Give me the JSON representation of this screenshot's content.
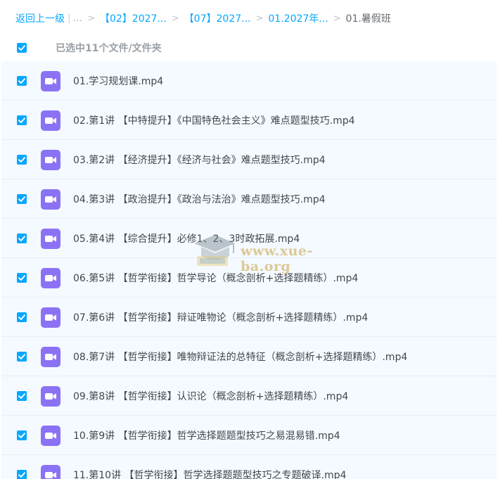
{
  "breadcrumb": {
    "back_label": "返回上一级",
    "separator_bar": "|",
    "ellipsis": "...",
    "separator": ">",
    "crumbs": [
      "【02】2027...",
      "【07】2027...",
      "01.2027年..."
    ],
    "current": "01.暑假班"
  },
  "selection": {
    "label": "已选中11个文件/文件夹",
    "all_checked": true
  },
  "files": [
    {
      "name": "01.学习规划课.mp4",
      "checked": true,
      "icon": "video-file-icon"
    },
    {
      "name": "02.第1讲 【中特提升】《中国特色社会主义》难点题型技巧.mp4",
      "checked": true,
      "icon": "video-file-icon"
    },
    {
      "name": "03.第2讲 【经济提升】《经济与社会》难点题型技巧.mp4",
      "checked": true,
      "icon": "video-file-icon"
    },
    {
      "name": "04.第3讲 【政治提升】《政治与法治》难点题型技巧.mp4",
      "checked": true,
      "icon": "video-file-icon"
    },
    {
      "name": "05.第4讲 【综合提升】必修1、2、3时政拓展.mp4",
      "checked": true,
      "icon": "video-file-icon"
    },
    {
      "name": "06.第5讲 【哲学衔接】哲学导论（概念剖析+选择题精练）.mp4",
      "checked": true,
      "icon": "video-file-icon"
    },
    {
      "name": "07.第6讲 【哲学衔接】辩证唯物论（概念剖析+选择题精练）.mp4",
      "checked": true,
      "icon": "video-file-icon"
    },
    {
      "name": "08.第7讲 【哲学衔接】唯物辩证法的总特征（概念剖析+选择题精练）.mp4",
      "checked": true,
      "icon": "video-file-icon"
    },
    {
      "name": "09.第8讲 【哲学衔接】认识论（概念剖析+选择题精练）.mp4",
      "checked": true,
      "icon": "video-file-icon"
    },
    {
      "name": "10.第9讲 【哲学衔接】哲学选择题题型技巧之易混易错.mp4",
      "checked": true,
      "icon": "video-file-icon"
    },
    {
      "name": "11.第10讲 【哲学衔接】哲学选择题题型技巧之专题破译.mp4",
      "checked": true,
      "icon": "video-file-icon"
    }
  ],
  "watermark": {
    "text": "www.xue-ba.org"
  },
  "colors": {
    "accent": "#06a7ff",
    "video_icon": "#8b72f5",
    "list_bg": "#f4faff"
  }
}
